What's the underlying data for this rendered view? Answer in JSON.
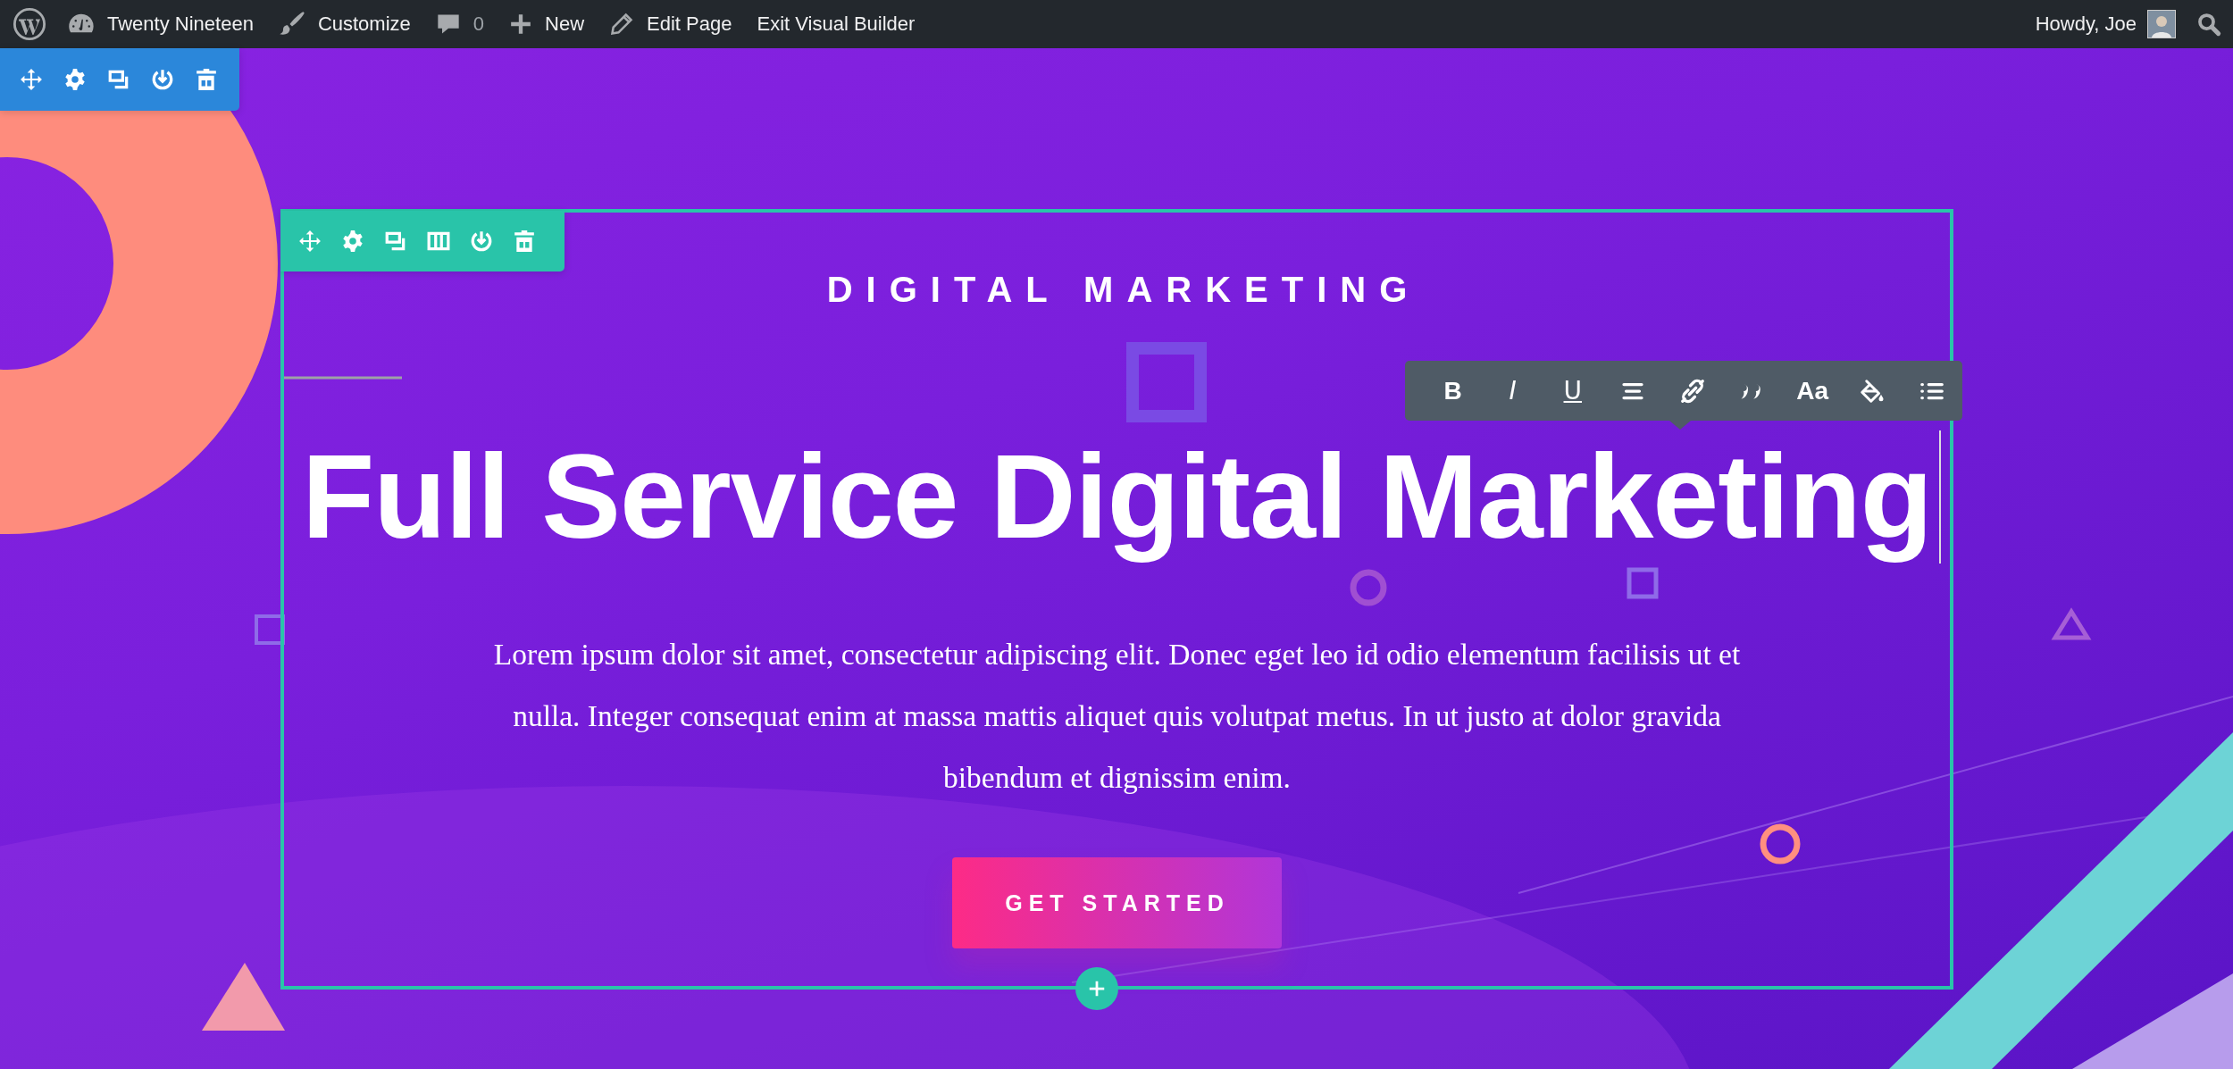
{
  "admin_bar": {
    "items": [
      {
        "kind": "site",
        "label": "Twenty Nineteen"
      },
      {
        "kind": "customize",
        "label": "Customize"
      },
      {
        "kind": "comments",
        "label": "0"
      },
      {
        "kind": "new",
        "label": "New"
      },
      {
        "kind": "edit",
        "label": "Edit Page"
      },
      {
        "kind": "exit",
        "label": "Exit Visual Builder"
      }
    ],
    "account": {
      "label": "Howdy, Joe"
    }
  },
  "hero": {
    "eyebrow": "DIGITAL MARKETING",
    "title": "Full Service Digital Marketing",
    "body": "Lorem ipsum dolor sit amet, consectetur adipiscing elit. Donec eget leo id odio elementum facilisis ut et nulla. Integer consequat enim at massa mattis aliquet quis volutpat metus. In ut justo at dolor gravida bibendum et dignissim enim.",
    "button": "GET STARTED"
  },
  "text_toolbar": {
    "items": [
      {
        "kind": "bold",
        "label": "B"
      },
      {
        "kind": "italic",
        "label": "I"
      },
      {
        "kind": "underline",
        "label": "U"
      },
      {
        "kind": "align"
      },
      {
        "kind": "link"
      },
      {
        "kind": "quote"
      },
      {
        "kind": "font",
        "label": "Aa"
      },
      {
        "kind": "color"
      },
      {
        "kind": "list"
      }
    ]
  }
}
